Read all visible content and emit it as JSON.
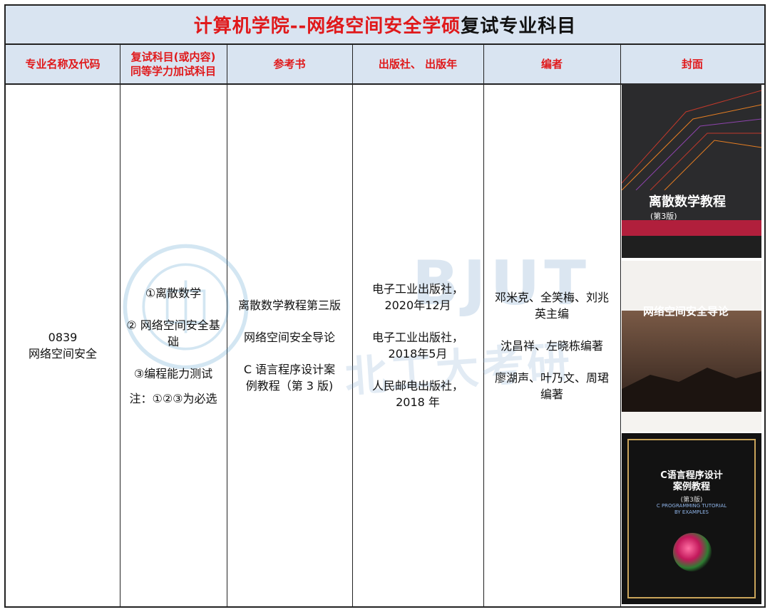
{
  "title": {
    "red_part": "计算机学院--网络空间安全学硕",
    "black_part": "复试专业科目"
  },
  "headers": {
    "major": "专业名称及代码",
    "subjects_line1": "复试科目(或内容)",
    "subjects_line2": "同等学力加试科目",
    "books": "参考书",
    "publisher": "出版社、 出版年",
    "authors": "编者",
    "cover": "封面"
  },
  "major": {
    "code": "0839",
    "name": "网络空间安全"
  },
  "subjects": {
    "item1": "①离散数学",
    "item2_line1": "② 网络空间安全基",
    "item2_line2": "础",
    "item3": "③编程能力测试",
    "note": "注：①②③为必选"
  },
  "books": {
    "book1": "离散数学教程第三版",
    "book2": "网络空间安全导论",
    "book3_line1": "C 语言程序设计案",
    "book3_line2": "例教程（第 3 版)"
  },
  "publishers": {
    "p1_line1": "电子工业出版社，",
    "p1_line2": "2020年12月",
    "p2_line1": "电子工业出版社，",
    "p2_line2": "2018年5月",
    "p3_line1": "人民邮电出版社，",
    "p3_line2": "2018 年"
  },
  "authors": {
    "a1_line1": "邓米克、全笑梅、刘兆",
    "a1_line2": "英主编",
    "a2": "沈昌祥、左晓栋编著",
    "a3_line1": "廖湖声、叶乃文、周珺",
    "a3_line2": "编著"
  },
  "covers": {
    "cover1_title": "离散数学教程",
    "cover1_edition": "(第3版)",
    "cover2_title": "网络空间安全导论",
    "cover3_title_line1": "C语言程序设计",
    "cover3_title_line2": "案例教程",
    "cover3_edition": "(第3版)",
    "cover3_en_line1": "C PROGRAMMING TUTORIAL",
    "cover3_en_line2": "BY EXAMPLES"
  },
  "watermark": {
    "text_en": "BJUT",
    "text_cn": "北工大考研"
  },
  "colors": {
    "header_bg": "#d9e4f1",
    "accent_red": "#e0191b",
    "watermark_blue": "#7fa8cf"
  }
}
